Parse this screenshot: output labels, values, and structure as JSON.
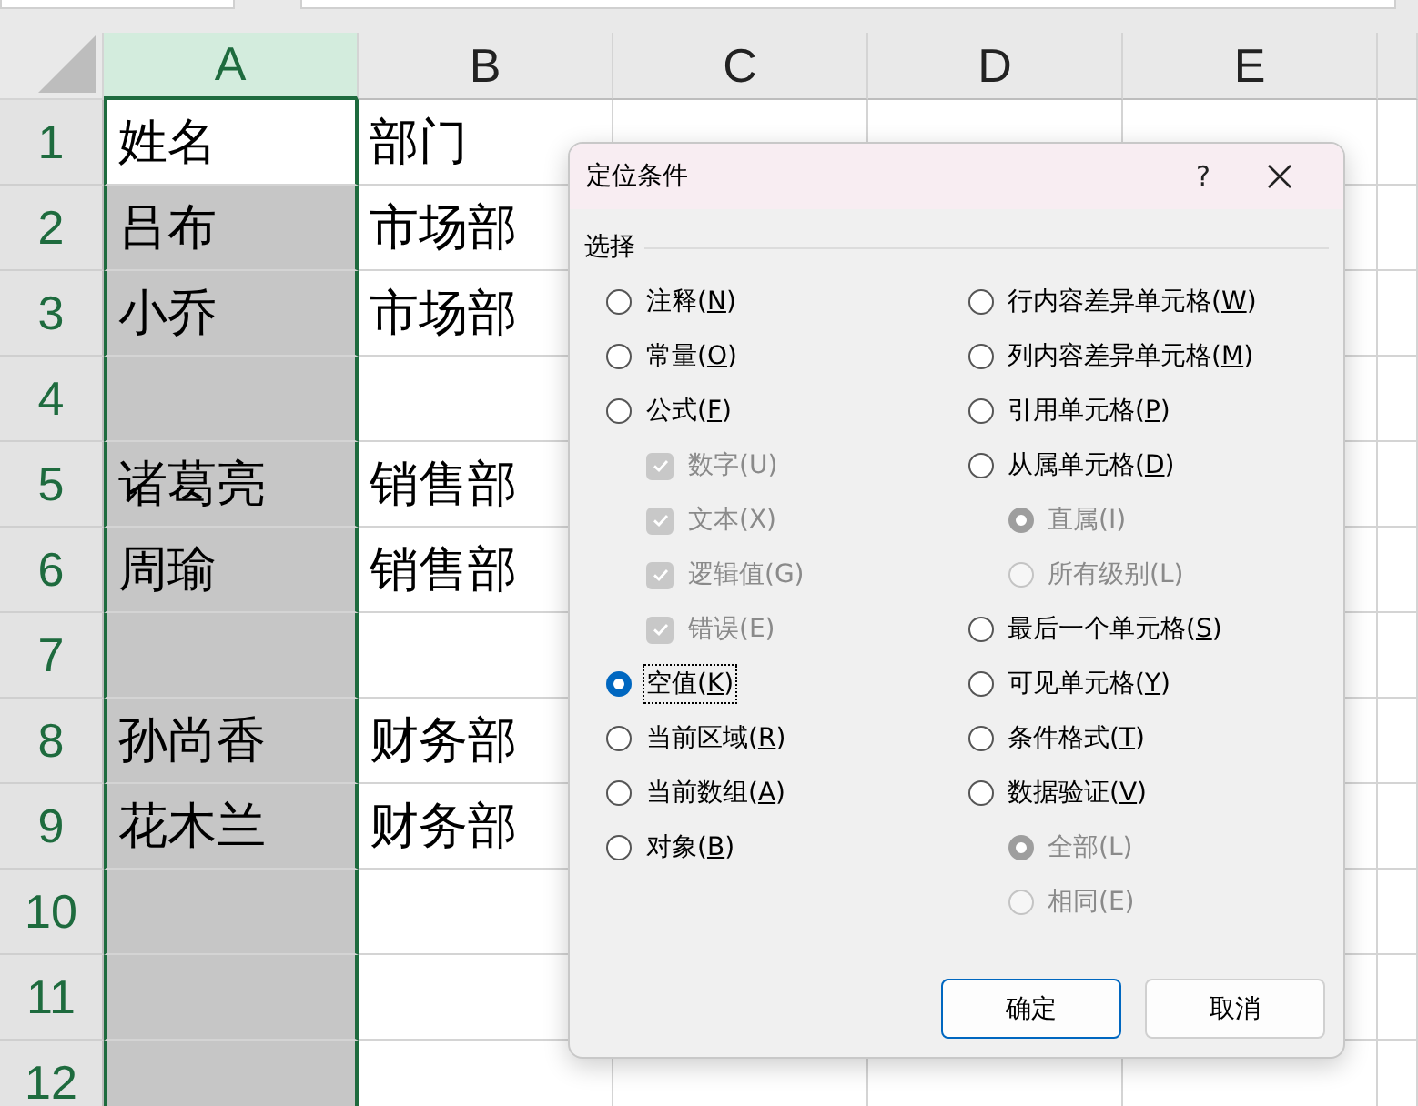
{
  "sheet": {
    "columns": [
      {
        "label": "A",
        "selected": true
      },
      {
        "label": "B",
        "selected": false
      },
      {
        "label": "C",
        "selected": false
      },
      {
        "label": "D",
        "selected": false
      },
      {
        "label": "E",
        "selected": false
      }
    ],
    "rows": [
      {
        "number": "1",
        "active": true,
        "cells": [
          "姓名",
          "部门"
        ]
      },
      {
        "number": "2",
        "active": false,
        "cells": [
          "吕布",
          "市场部"
        ]
      },
      {
        "number": "3",
        "active": false,
        "cells": [
          "小乔",
          "市场部"
        ]
      },
      {
        "number": "4",
        "active": false,
        "cells": []
      },
      {
        "number": "5",
        "active": false,
        "cells": [
          "诸葛亮",
          "销售部"
        ]
      },
      {
        "number": "6",
        "active": false,
        "cells": [
          "周瑜",
          "销售部"
        ]
      },
      {
        "number": "7",
        "active": false,
        "cells": []
      },
      {
        "number": "8",
        "active": false,
        "cells": [
          "孙尚香",
          "财务部"
        ]
      },
      {
        "number": "9",
        "active": false,
        "cells": [
          "花木兰",
          "财务部"
        ]
      },
      {
        "number": "10",
        "active": false,
        "cells": []
      },
      {
        "number": "11",
        "active": false,
        "cells": []
      },
      {
        "number": "12",
        "active": false,
        "cells": []
      }
    ]
  },
  "dialog": {
    "title": "定位条件",
    "help": "?",
    "group_label": "选择",
    "columns": [
      [
        {
          "kind": "radio",
          "label": "注释(",
          "key": "N",
          "end": ")",
          "selected": false,
          "disabled": false
        },
        {
          "kind": "radio",
          "label": "常量(",
          "key": "O",
          "end": ")",
          "selected": false,
          "disabled": false
        },
        {
          "kind": "radio",
          "label": "公式(",
          "key": "F",
          "end": ")",
          "selected": false,
          "disabled": false,
          "children": [
            {
              "kind": "checkbox",
              "label": "数字(U)",
              "checked": true,
              "disabled": true
            },
            {
              "kind": "checkbox",
              "label": "文本(X)",
              "checked": true,
              "disabled": true
            },
            {
              "kind": "checkbox",
              "label": "逻辑值(G)",
              "checked": true,
              "disabled": true
            },
            {
              "kind": "checkbox",
              "label": "错误(E)",
              "checked": true,
              "disabled": true
            }
          ]
        },
        {
          "kind": "radio",
          "label": "空值(",
          "key": "K",
          "end": ")",
          "selected": true,
          "disabled": false,
          "focused": true
        },
        {
          "kind": "radio",
          "label": "当前区域(",
          "key": "R",
          "end": ")",
          "selected": false,
          "disabled": false
        },
        {
          "kind": "radio",
          "label": "当前数组(",
          "key": "A",
          "end": ")",
          "selected": false,
          "disabled": false
        },
        {
          "kind": "radio",
          "label": "对象(",
          "key": "B",
          "end": ")",
          "selected": false,
          "disabled": false
        }
      ],
      [
        {
          "kind": "radio",
          "label": "行内容差异单元格(",
          "key": "W",
          "end": ")",
          "selected": false,
          "disabled": false
        },
        {
          "kind": "radio",
          "label": "列内容差异单元格(",
          "key": "M",
          "end": ")",
          "selected": false,
          "disabled": false
        },
        {
          "kind": "radio",
          "label": "引用单元格(",
          "key": "P",
          "end": ")",
          "selected": false,
          "disabled": false
        },
        {
          "kind": "radio",
          "label": "从属单元格(",
          "key": "D",
          "end": ")",
          "selected": false,
          "disabled": false,
          "children": [
            {
              "kind": "radio",
              "label": "直属(I)",
              "selected": true,
              "disabled": true
            },
            {
              "kind": "radio",
              "label": "所有级别(L)",
              "selected": false,
              "disabled": true
            }
          ]
        },
        {
          "kind": "radio",
          "label": "最后一个单元格(",
          "key": "S",
          "end": ")",
          "selected": false,
          "disabled": false
        },
        {
          "kind": "radio",
          "label": "可见单元格(",
          "key": "Y",
          "end": ")",
          "selected": false,
          "disabled": false
        },
        {
          "kind": "radio",
          "label": "条件格式(",
          "key": "T",
          "end": ")",
          "selected": false,
          "disabled": false
        },
        {
          "kind": "radio",
          "label": "数据验证(",
          "key": "V",
          "end": ")",
          "selected": false,
          "disabled": false,
          "children": [
            {
              "kind": "radio",
              "label": "全部(L)",
              "selected": true,
              "disabled": true
            },
            {
              "kind": "radio",
              "label": "相同(E)",
              "selected": false,
              "disabled": true
            }
          ]
        }
      ]
    ],
    "buttons": [
      {
        "label": "确定",
        "default": true
      },
      {
        "label": "取消",
        "default": false
      }
    ]
  }
}
